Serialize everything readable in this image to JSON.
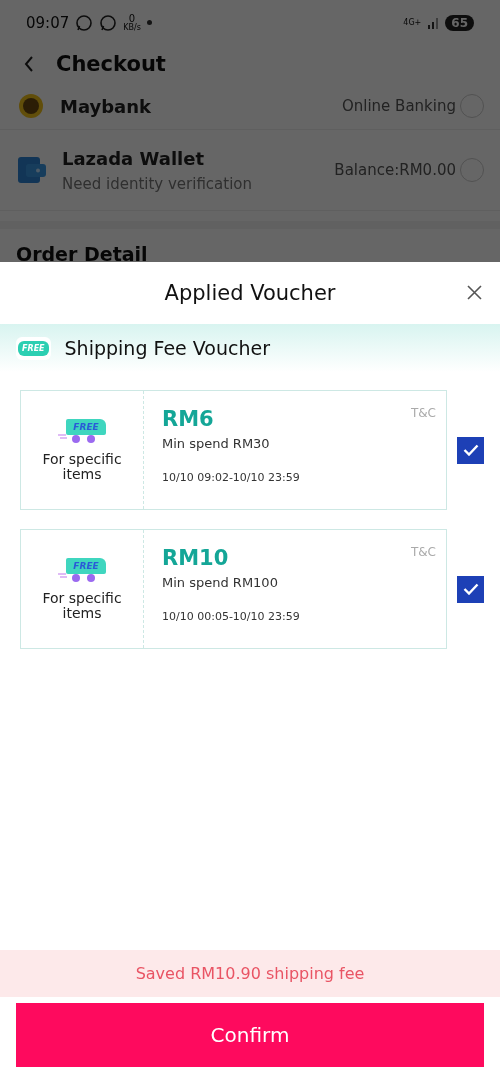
{
  "status_bar": {
    "time": "09:07",
    "net_speed": "0",
    "net_unit": "KB/s",
    "network": "4G+",
    "battery": "65"
  },
  "page": {
    "title": "Checkout",
    "payment_methods": [
      {
        "name": "Maybank",
        "kind": "bank",
        "detail": "Online Banking",
        "selected": false
      },
      {
        "name": "Lazada Wallet",
        "kind": "wallet",
        "detail": "Balance:RM0.00",
        "note": "Need identity verification",
        "selected": false
      }
    ],
    "next_section": "Order Detail"
  },
  "sheet": {
    "title": "Applied Voucher",
    "section": {
      "badge": "FREE",
      "title": "Shipping Fee Voucher"
    },
    "vouchers": [
      {
        "badge": "FREE",
        "scope": "For specific items",
        "amount": "RM6",
        "condition": "Min spend RM30",
        "validity": "10/10 09:02-10/10 23:59",
        "terms": "T&C",
        "checked": true
      },
      {
        "badge": "FREE",
        "scope": "For specific items",
        "amount": "RM10",
        "condition": "Min spend RM100",
        "validity": "10/10 00:05-10/10 23:59",
        "terms": "T&C",
        "checked": true
      }
    ],
    "summary": "Saved RM10.90 shipping fee",
    "confirm": "Confirm"
  }
}
